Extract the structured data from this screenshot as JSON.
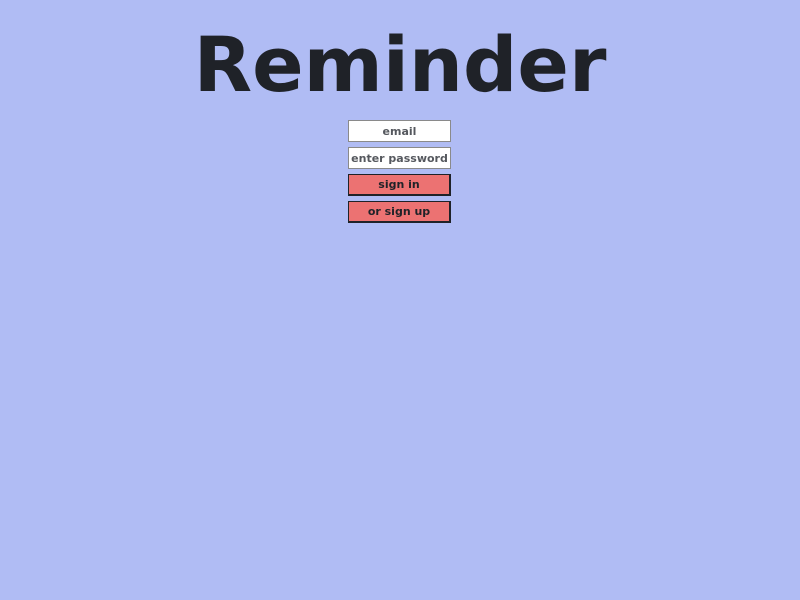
{
  "app": {
    "title": "Reminder"
  },
  "login_form": {
    "email_placeholder": "email",
    "password_placeholder": "enter password",
    "sign_in_label": "sign in",
    "sign_up_label": "or sign up"
  },
  "colors": {
    "background": "#b0bcf4",
    "title_text": "#1f2228",
    "button_background": "#ec7272",
    "button_border": "#1f2228",
    "input_background": "#ffffff"
  }
}
